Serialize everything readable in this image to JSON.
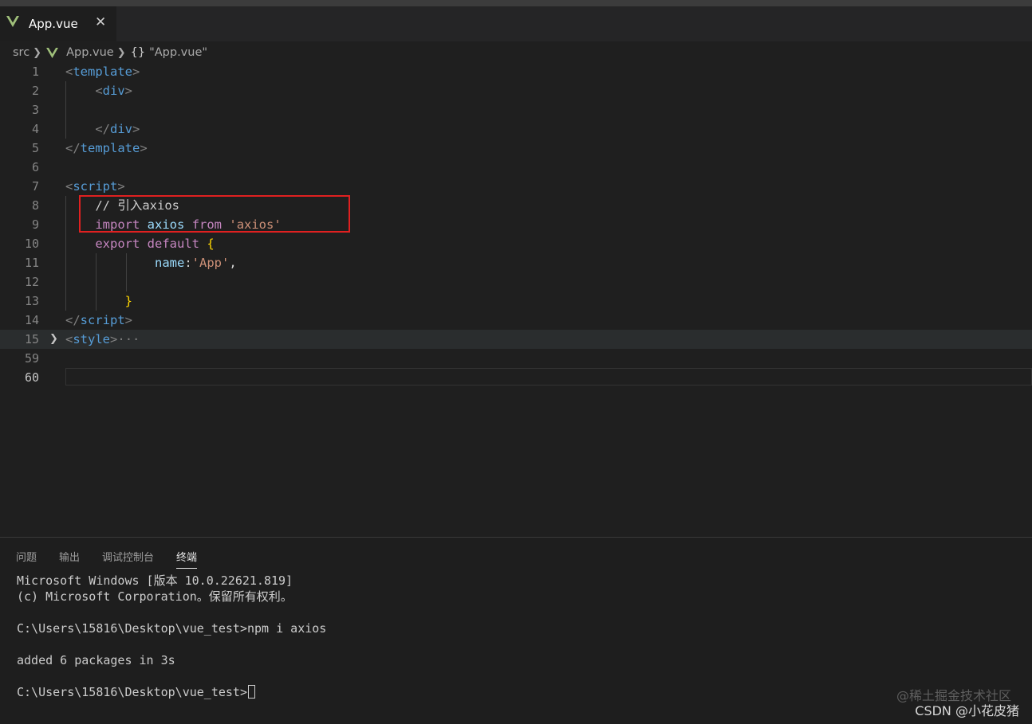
{
  "tab": {
    "label": "App.vue",
    "close": "✕"
  },
  "breadcrumb": {
    "folder": "src",
    "file": "App.vue",
    "braces": "{}",
    "symbol": "\"App.vue\""
  },
  "editor": {
    "lines": [
      {
        "num": "1",
        "tokens": [
          [
            "t-punc",
            "<"
          ],
          [
            "t-tag",
            "template"
          ],
          [
            "t-punc",
            ">"
          ]
        ]
      },
      {
        "num": "2",
        "tokens": [
          [
            "t-plain",
            "    "
          ],
          [
            "t-punc",
            "<"
          ],
          [
            "t-tag",
            "div"
          ],
          [
            "t-punc",
            ">"
          ]
        ]
      },
      {
        "num": "3",
        "tokens": []
      },
      {
        "num": "4",
        "tokens": [
          [
            "t-plain",
            "    "
          ],
          [
            "t-punc",
            "</"
          ],
          [
            "t-tag",
            "div"
          ],
          [
            "t-punc",
            ">"
          ]
        ]
      },
      {
        "num": "5",
        "tokens": [
          [
            "t-punc",
            "</"
          ],
          [
            "t-tag",
            "template"
          ],
          [
            "t-punc",
            ">"
          ]
        ]
      },
      {
        "num": "6",
        "tokens": []
      },
      {
        "num": "7",
        "tokens": [
          [
            "t-punc",
            "<"
          ],
          [
            "t-tag",
            "script"
          ],
          [
            "t-punc",
            ">"
          ]
        ]
      },
      {
        "num": "8",
        "tokens": [
          [
            "t-plain",
            "    "
          ],
          [
            "t-com",
            "// 引入axios"
          ]
        ]
      },
      {
        "num": "9",
        "tokens": [
          [
            "t-plain",
            "    "
          ],
          [
            "t-kw",
            "import"
          ],
          [
            "t-plain",
            " "
          ],
          [
            "t-var",
            "axios"
          ],
          [
            "t-plain",
            " "
          ],
          [
            "t-kw",
            "from"
          ],
          [
            "t-plain",
            " "
          ],
          [
            "t-str",
            "'axios'"
          ]
        ]
      },
      {
        "num": "10",
        "tokens": [
          [
            "t-plain",
            "    "
          ],
          [
            "t-kw",
            "export"
          ],
          [
            "t-plain",
            " "
          ],
          [
            "t-kw",
            "default"
          ],
          [
            "t-plain",
            " "
          ],
          [
            "t-brace",
            "{"
          ]
        ]
      },
      {
        "num": "11",
        "tokens": [
          [
            "t-plain",
            "            "
          ],
          [
            "t-var",
            "name"
          ],
          [
            "t-plain",
            ":"
          ],
          [
            "t-str",
            "'App'"
          ],
          [
            "t-plain",
            ","
          ]
        ]
      },
      {
        "num": "12",
        "tokens": []
      },
      {
        "num": "13",
        "tokens": [
          [
            "t-plain",
            "        "
          ],
          [
            "t-brace",
            "}"
          ]
        ]
      },
      {
        "num": "14",
        "tokens": [
          [
            "t-punc",
            "</"
          ],
          [
            "t-tag",
            "script"
          ],
          [
            "t-punc",
            ">"
          ]
        ]
      },
      {
        "num": "15",
        "tokens": [
          [
            "t-punc",
            "<"
          ],
          [
            "t-tag",
            "style"
          ],
          [
            "t-punc",
            ">"
          ],
          [
            "ellipsis",
            "···"
          ]
        ],
        "folded": true
      },
      {
        "num": "59",
        "tokens": []
      },
      {
        "num": "60",
        "tokens": [],
        "current": true
      }
    ]
  },
  "panel": {
    "tabs": [
      "问题",
      "输出",
      "调试控制台",
      "终端"
    ],
    "active_tab": "终端",
    "terminal_lines": [
      "Microsoft Windows [版本 10.0.22621.819]",
      "(c) Microsoft Corporation。保留所有权利。",
      "",
      "C:\\Users\\15816\\Desktop\\vue_test>npm i axios",
      "",
      "added 6 packages in 3s",
      "",
      "C:\\Users\\15816\\Desktop\\vue_test>"
    ]
  },
  "watermark": {
    "line1": "@稀土掘金技术社区",
    "line2": "CSDN @小花皮猪"
  },
  "colors": {
    "highlight_box": "#e02020",
    "vue_green": "#41b883",
    "vue_dark": "#35495e"
  }
}
